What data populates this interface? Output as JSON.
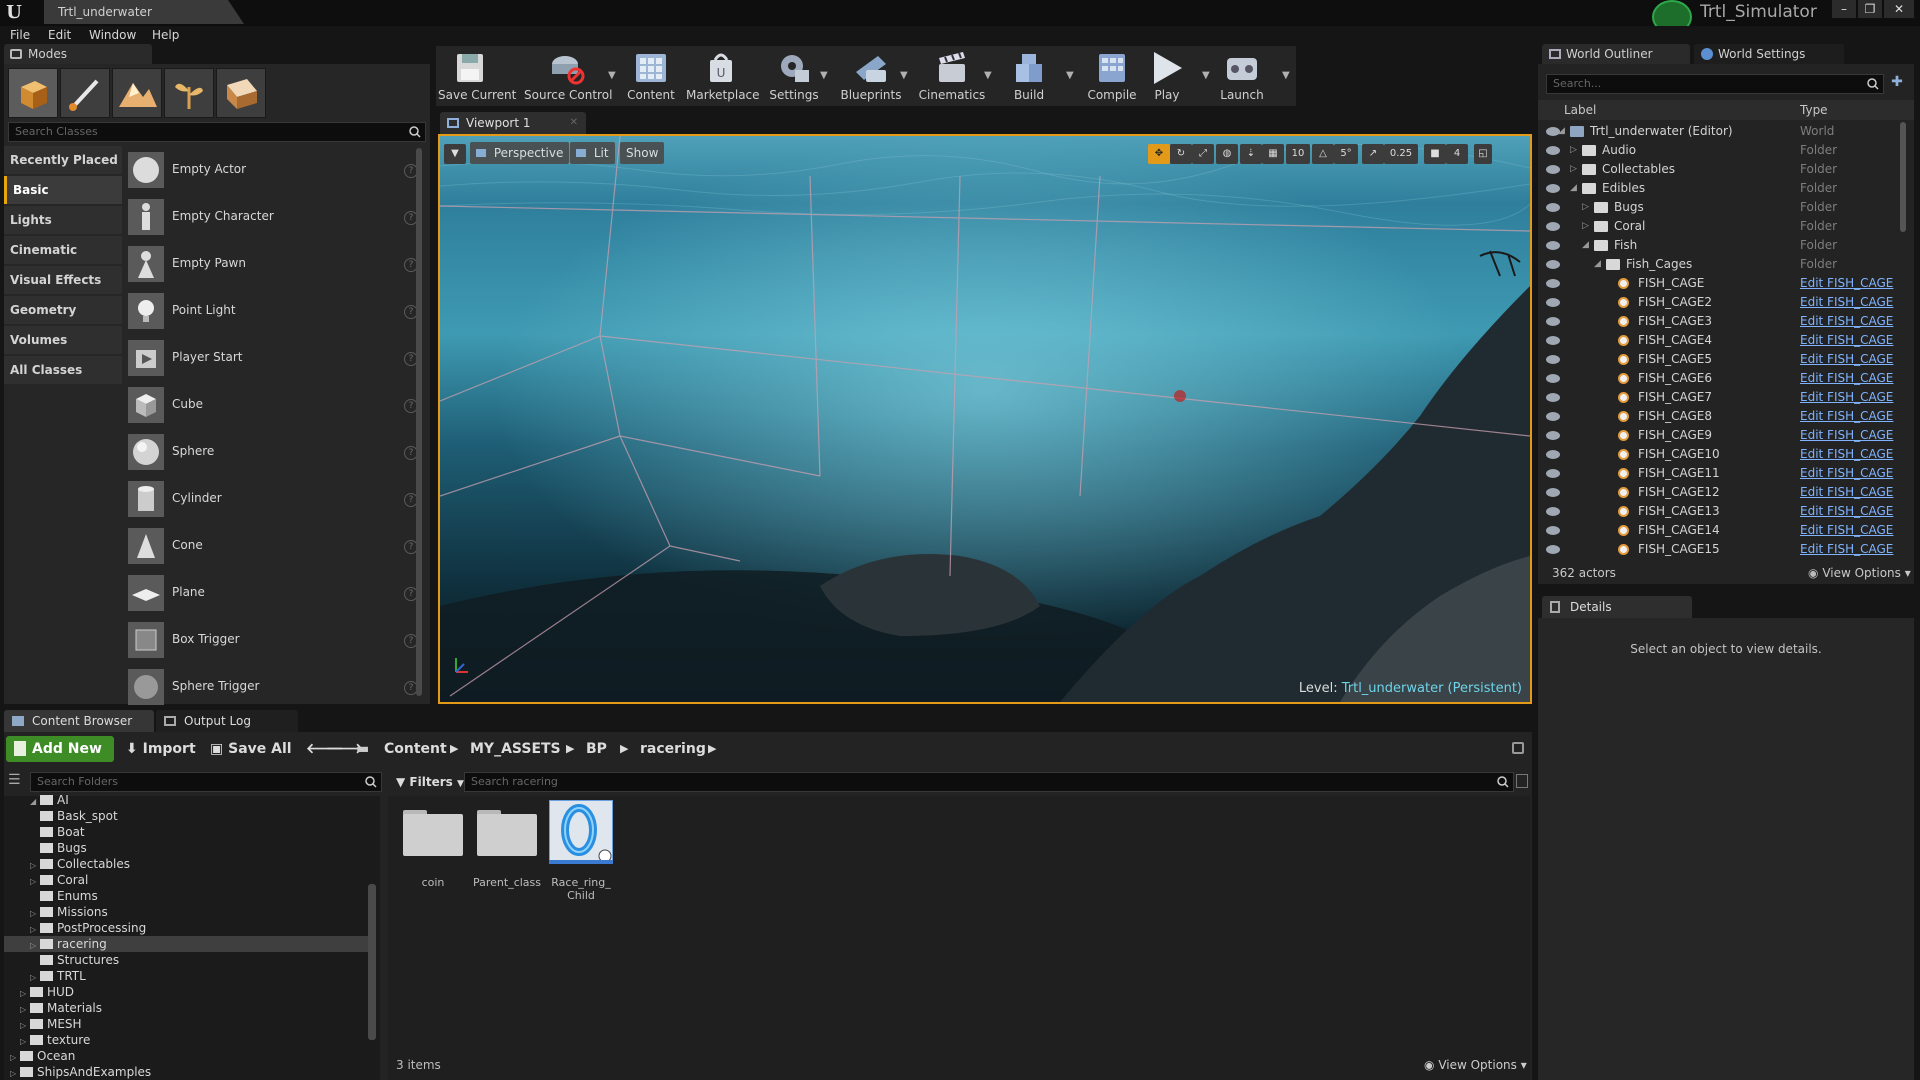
{
  "window": {
    "logo": "U",
    "doc_tab": "Trtl_underwater",
    "app_title": "Trtl_Simulator",
    "controls": [
      "–",
      "❐",
      "✕"
    ]
  },
  "menu": [
    "File",
    "Edit",
    "Window",
    "Help"
  ],
  "modes": {
    "tab_label": "Modes",
    "search_placeholder": "Search Classes",
    "mode_icons": [
      "place-mode-icon",
      "paint-mode-icon",
      "landscape-mode-icon",
      "foliage-mode-icon",
      "geometry-edit-mode-icon"
    ],
    "categories": [
      "Recently Placed",
      "Basic",
      "Lights",
      "Cinematic",
      "Visual Effects",
      "Geometry",
      "Volumes",
      "All Classes"
    ],
    "active_category": "Basic",
    "items": [
      "Empty Actor",
      "Empty Character",
      "Empty Pawn",
      "Point Light",
      "Player Start",
      "Cube",
      "Sphere",
      "Cylinder",
      "Cone",
      "Plane",
      "Box Trigger",
      "Sphere Trigger"
    ],
    "help_glyph": "?"
  },
  "toolbar": {
    "items": [
      "Save Current",
      "Source Control",
      "Content",
      "Marketplace",
      "Settings",
      "Blueprints",
      "Cinematics",
      "Build",
      "Compile",
      "Play",
      "Launch"
    ]
  },
  "viewport": {
    "tab_label": "Viewport 1",
    "perspective": "Perspective",
    "lit": "Lit",
    "show": "Show",
    "grid_snap": "10",
    "rotation_snap": "5°",
    "scale_snap": "0.25",
    "camera_speed": "4",
    "level_prefix": "Level:",
    "level_name": "Trtl_underwater (Persistent)"
  },
  "outliner": {
    "tab_label": "World Outliner",
    "settings_tab_label": "World Settings",
    "search_placeholder": "Search...",
    "col_label": "Label",
    "col_type": "Type",
    "rows": [
      {
        "label": "Trtl_underwater (Editor)",
        "type": "World",
        "depth": 0,
        "kind": "world",
        "arrow": "◢"
      },
      {
        "label": "Audio",
        "type": "Folder",
        "depth": 1,
        "kind": "folder",
        "arrow": "▷"
      },
      {
        "label": "Collectables",
        "type": "Folder",
        "depth": 1,
        "kind": "folder",
        "arrow": "▷"
      },
      {
        "label": "Edibles",
        "type": "Folder",
        "depth": 1,
        "kind": "folder",
        "arrow": "◢"
      },
      {
        "label": "Bugs",
        "type": "Folder",
        "depth": 2,
        "kind": "folder",
        "arrow": "▷"
      },
      {
        "label": "Coral",
        "type": "Folder",
        "depth": 2,
        "kind": "folder",
        "arrow": "▷"
      },
      {
        "label": "Fish",
        "type": "Folder",
        "depth": 2,
        "kind": "folder",
        "arrow": "◢"
      },
      {
        "label": "Fish_Cages",
        "type": "Folder",
        "depth": 3,
        "kind": "folder",
        "arrow": "◢"
      },
      {
        "label": "FISH_CAGE",
        "type": "Edit FISH_CAGE",
        "depth": 4,
        "kind": "actor",
        "arrow": ""
      },
      {
        "label": "FISH_CAGE2",
        "type": "Edit FISH_CAGE",
        "depth": 4,
        "kind": "actor",
        "arrow": ""
      },
      {
        "label": "FISH_CAGE3",
        "type": "Edit FISH_CAGE",
        "depth": 4,
        "kind": "actor",
        "arrow": ""
      },
      {
        "label": "FISH_CAGE4",
        "type": "Edit FISH_CAGE",
        "depth": 4,
        "kind": "actor",
        "arrow": ""
      },
      {
        "label": "FISH_CAGE5",
        "type": "Edit FISH_CAGE",
        "depth": 4,
        "kind": "actor",
        "arrow": ""
      },
      {
        "label": "FISH_CAGE6",
        "type": "Edit FISH_CAGE",
        "depth": 4,
        "kind": "actor",
        "arrow": ""
      },
      {
        "label": "FISH_CAGE7",
        "type": "Edit FISH_CAGE",
        "depth": 4,
        "kind": "actor",
        "arrow": ""
      },
      {
        "label": "FISH_CAGE8",
        "type": "Edit FISH_CAGE",
        "depth": 4,
        "kind": "actor",
        "arrow": ""
      },
      {
        "label": "FISH_CAGE9",
        "type": "Edit FISH_CAGE",
        "depth": 4,
        "kind": "actor",
        "arrow": ""
      },
      {
        "label": "FISH_CAGE10",
        "type": "Edit FISH_CAGE",
        "depth": 4,
        "kind": "actor",
        "arrow": ""
      },
      {
        "label": "FISH_CAGE11",
        "type": "Edit FISH_CAGE",
        "depth": 4,
        "kind": "actor",
        "arrow": ""
      },
      {
        "label": "FISH_CAGE12",
        "type": "Edit FISH_CAGE",
        "depth": 4,
        "kind": "actor",
        "arrow": ""
      },
      {
        "label": "FISH_CAGE13",
        "type": "Edit FISH_CAGE",
        "depth": 4,
        "kind": "actor",
        "arrow": ""
      },
      {
        "label": "FISH_CAGE14",
        "type": "Edit FISH_CAGE",
        "depth": 4,
        "kind": "actor",
        "arrow": ""
      },
      {
        "label": "FISH_CAGE15",
        "type": "Edit FISH_CAGE",
        "depth": 4,
        "kind": "actor",
        "arrow": ""
      }
    ],
    "actor_count": "362 actors",
    "view_options": "View Options"
  },
  "details": {
    "tab_label": "Details",
    "empty_message": "Select an object to view details."
  },
  "content_browser": {
    "tab_label": "Content Browser",
    "output_tab_label": "Output Log",
    "add_new": "Add New",
    "import": "Import",
    "save_all": "Save All",
    "breadcrumbs": [
      "Content",
      "MY_ASSETS",
      "BP",
      "racering"
    ],
    "folder_search_placeholder": "Search Folders",
    "filters": "Filters",
    "asset_search_placeholder": "Search racering",
    "tree": [
      {
        "label": "AI",
        "depth": 2,
        "arrow": "◢",
        "selected": false
      },
      {
        "label": "Bask_spot",
        "depth": 2,
        "arrow": "",
        "selected": false
      },
      {
        "label": "Boat",
        "depth": 2,
        "arrow": "",
        "selected": false
      },
      {
        "label": "Bugs",
        "depth": 2,
        "arrow": "",
        "selected": false
      },
      {
        "label": "Collectables",
        "depth": 2,
        "arrow": "▷",
        "selected": false
      },
      {
        "label": "Coral",
        "depth": 2,
        "arrow": "▷",
        "selected": false
      },
      {
        "label": "Enums",
        "depth": 2,
        "arrow": "",
        "selected": false
      },
      {
        "label": "Missions",
        "depth": 2,
        "arrow": "▷",
        "selected": false
      },
      {
        "label": "PostProcessing",
        "depth": 2,
        "arrow": "▷",
        "selected": false
      },
      {
        "label": "racering",
        "depth": 2,
        "arrow": "▷",
        "selected": true
      },
      {
        "label": "Structures",
        "depth": 2,
        "arrow": "",
        "selected": false
      },
      {
        "label": "TRTL",
        "depth": 2,
        "arrow": "▷",
        "selected": false
      },
      {
        "label": "HUD",
        "depth": 1,
        "arrow": "▷",
        "selected": false
      },
      {
        "label": "Materials",
        "depth": 1,
        "arrow": "▷",
        "selected": false
      },
      {
        "label": "MESH",
        "depth": 1,
        "arrow": "▷",
        "selected": false
      },
      {
        "label": "texture",
        "depth": 1,
        "arrow": "▷",
        "selected": false
      },
      {
        "label": "Ocean",
        "depth": 0,
        "arrow": "▷",
        "selected": false
      },
      {
        "label": "ShipsAndExamples",
        "depth": 0,
        "arrow": "▷",
        "selected": false
      }
    ],
    "assets": [
      {
        "name": "coin",
        "kind": "folder"
      },
      {
        "name": "Parent_class",
        "kind": "folder"
      },
      {
        "name": "Race_ring_ Child",
        "kind": "blueprint"
      }
    ],
    "item_count": "3 items",
    "view_options": "View Options"
  },
  "colors": {
    "accent": "#e39a19",
    "add_new_green": "#3e8c25",
    "link_blue": "#7fb3ff",
    "level_cyan": "#6ed3e8"
  }
}
